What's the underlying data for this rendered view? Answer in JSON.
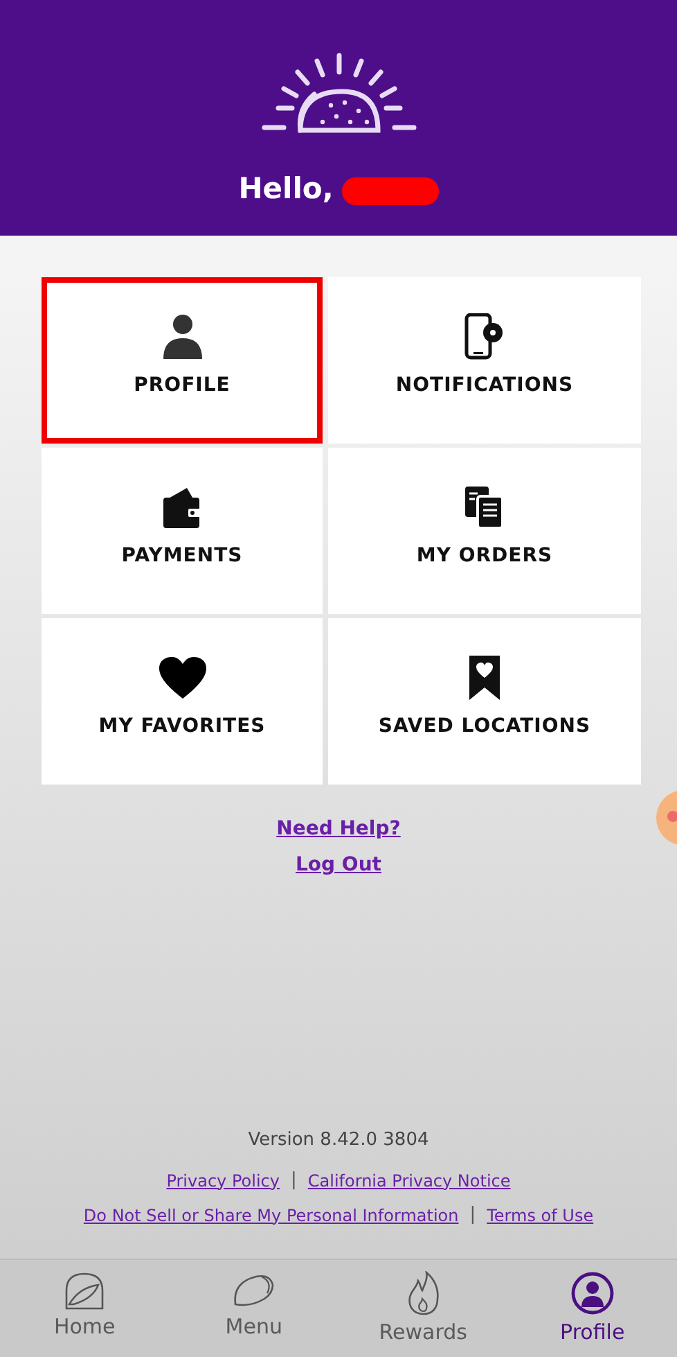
{
  "header": {
    "greeting": "Hello,",
    "name_redacted": true
  },
  "tiles": [
    {
      "label": "PROFILE",
      "highlighted": true
    },
    {
      "label": "NOTIFICATIONS",
      "highlighted": false
    },
    {
      "label": "PAYMENTS",
      "highlighted": false
    },
    {
      "label": "MY ORDERS",
      "highlighted": false
    },
    {
      "label": "MY FAVORITES",
      "highlighted": false
    },
    {
      "label": "SAVED LOCATIONS",
      "highlighted": false
    }
  ],
  "help_links": [
    "Need Help?",
    "Log Out"
  ],
  "footer": {
    "version": "Version 8.42.0 3804",
    "link_rows": [
      [
        "Privacy Policy",
        "California Privacy Notice"
      ],
      [
        "Do Not Sell or Share My Personal Information",
        "Terms of Use"
      ]
    ],
    "separator": "|"
  },
  "tab_bar": [
    {
      "label": "Home",
      "selected": false
    },
    {
      "label": "Menu",
      "selected": false
    },
    {
      "label": "Rewards",
      "selected": false
    },
    {
      "label": "Profile",
      "selected": true
    }
  ]
}
